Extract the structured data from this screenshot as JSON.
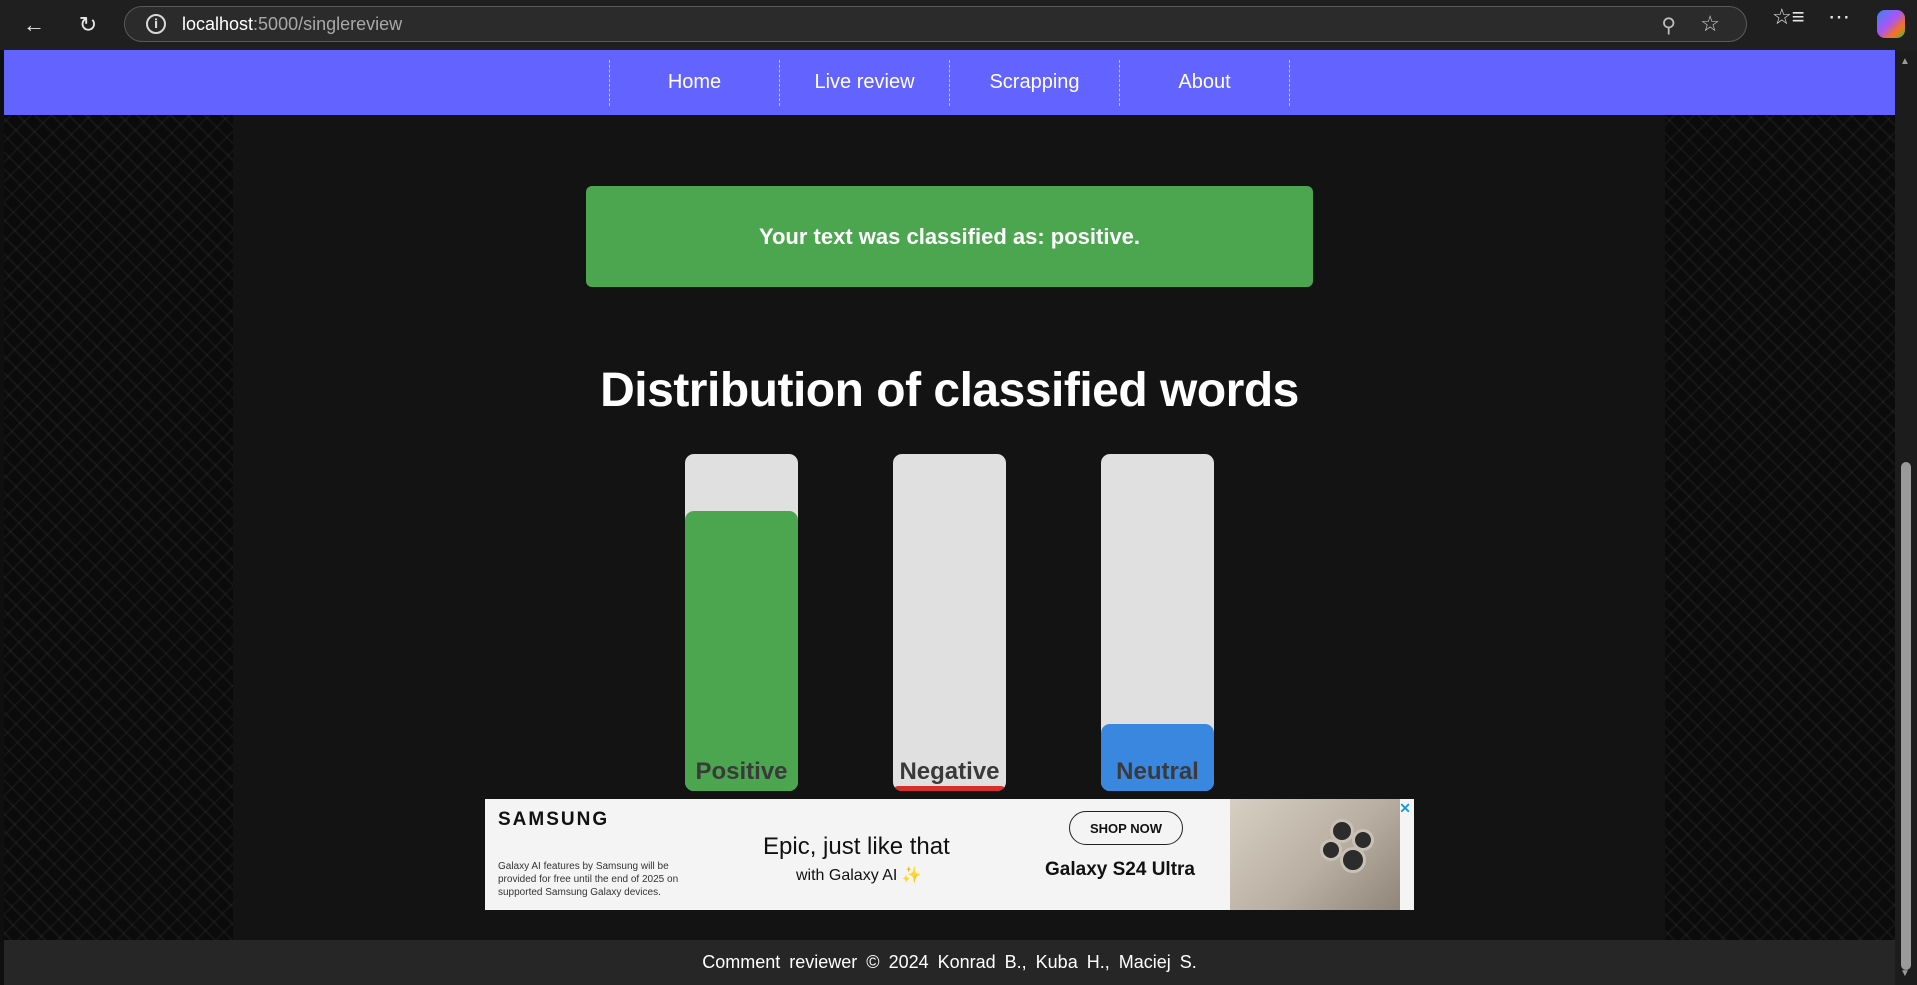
{
  "browser": {
    "url_host": "localhost",
    "url_path": ":5000/singlereview"
  },
  "nav": {
    "items": [
      "Home",
      "Live review",
      "Scrapping",
      "About"
    ]
  },
  "result": {
    "text": "Your text was classified as: positive."
  },
  "distribution": {
    "title": "Distribution of classified words",
    "bars": [
      {
        "label": "Positive",
        "fraction": 0.83,
        "color": "#4ca64f"
      },
      {
        "label": "Negative",
        "fraction": 0.015,
        "color": "#d32f2f"
      },
      {
        "label": "Neutral",
        "fraction": 0.2,
        "color": "#3a87e0"
      }
    ]
  },
  "ad": {
    "brand": "SAMSUNG",
    "disclaimer": "Galaxy AI features by Samsung will be provided for free until the end of 2025 on supported Samsung Galaxy devices.",
    "headline": "Epic, just like that",
    "subline": "with Galaxy AI ✨",
    "cta": "SHOP NOW",
    "product": "Galaxy S24 Ultra"
  },
  "footer": {
    "text": "Comment reviewer © 2024 Konrad B., Kuba H., Maciej S."
  }
}
